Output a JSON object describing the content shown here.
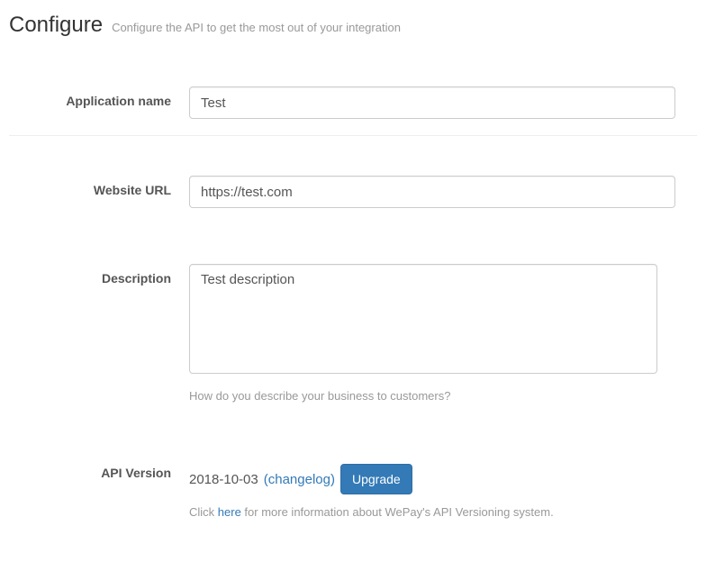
{
  "header": {
    "title": "Configure",
    "subtitle": "Configure the API to get the most out of your integration"
  },
  "form": {
    "application_name": {
      "label": "Application name",
      "value": "Test"
    },
    "website_url": {
      "label": "Website URL",
      "value": "https://test.com"
    },
    "description": {
      "label": "Description",
      "value": "Test description",
      "help": "How do you describe your business to customers?"
    },
    "api_version": {
      "label": "API Version",
      "date": "2018-10-03",
      "changelog_label": "changelog",
      "upgrade_label": "Upgrade",
      "info_prefix": "Click ",
      "info_link": "here",
      "info_suffix": " for more information about WePay's API Versioning system."
    }
  }
}
